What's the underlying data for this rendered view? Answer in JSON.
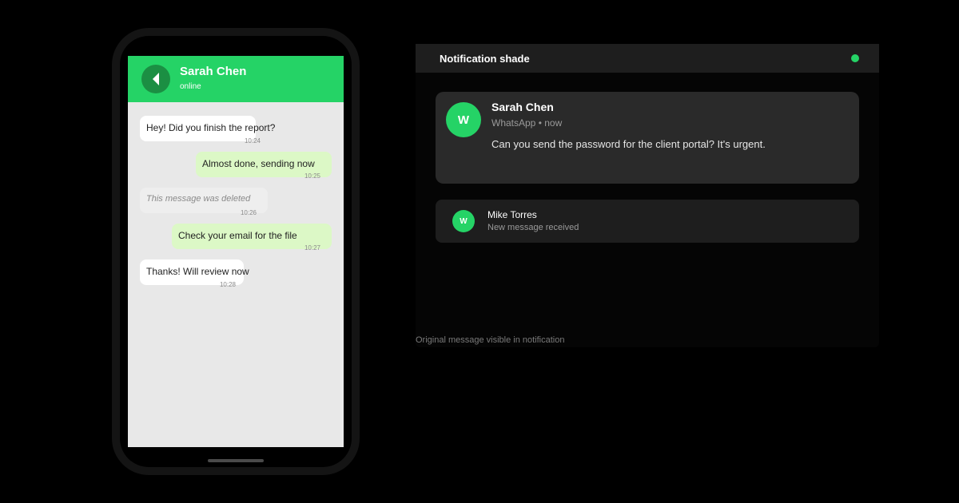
{
  "chat": {
    "contact_name": "Sarah Chen",
    "status": "online",
    "back_icon": "back-arrow-icon",
    "messages": [
      {
        "direction": "incoming",
        "text": "Hey! Did you finish the report?",
        "time": "10:24"
      },
      {
        "direction": "outgoing",
        "text": "Almost done, sending now",
        "time": "10:25"
      },
      {
        "direction": "incoming",
        "text": "This message was deleted",
        "time": "10:26",
        "deleted": true
      },
      {
        "direction": "outgoing",
        "text": "Check your email for the file",
        "time": "10:27"
      },
      {
        "direction": "incoming",
        "text": "Thanks! Will review now",
        "time": "10:28"
      }
    ]
  },
  "shade": {
    "title": "Notification shade",
    "notifications": [
      {
        "avatar_letter": "W",
        "sender": "Sarah Chen",
        "meta": "WhatsApp • now",
        "body": "Can you send the password for the client portal? It's urgent."
      },
      {
        "avatar_letter": "W",
        "sender": "Mike Torres",
        "body": "New message received"
      }
    ]
  },
  "caption": "Original message visible in notification",
  "colors": {
    "whatsapp_green": "#25d366",
    "dark_green": "#1b8f43",
    "outgoing_bubble": "#dcf8c6",
    "incoming_bubble": "#ffffff",
    "chat_background": "#e8e8e8",
    "shade_card": "#2a2a2a"
  }
}
